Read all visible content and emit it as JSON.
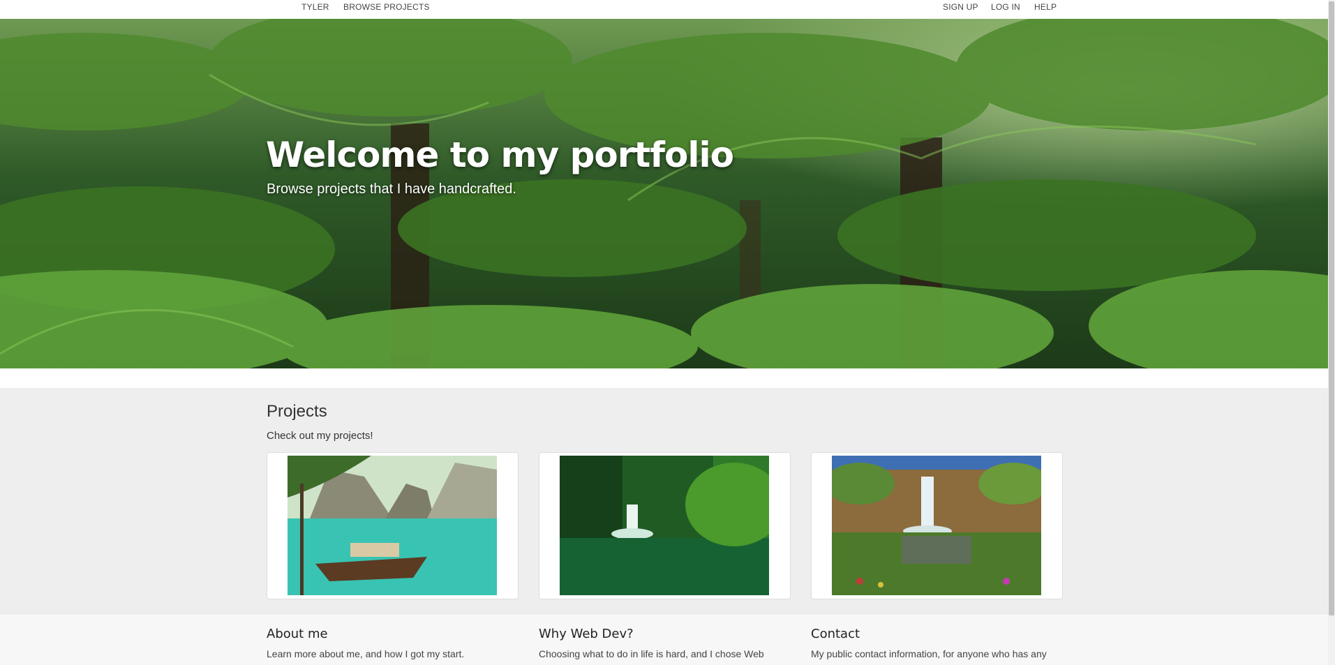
{
  "nav": {
    "brand": "TYLER",
    "browse": "BROWSE PROJECTS",
    "signup": "SIGN UP",
    "login": "LOG IN",
    "help": "HELP"
  },
  "hero": {
    "title": "Welcome to my portfolio",
    "subtitle": "Browse projects that I have handcrafted."
  },
  "projects": {
    "title": "Projects",
    "subtitle": "Check out my projects!",
    "cards": [
      "tropical-lagoon-boat-image",
      "jungle-waterfall-image",
      "canyon-waterfall-image"
    ]
  },
  "footer": {
    "about": {
      "title": "About me",
      "text": "Learn more about me, and how I got my start."
    },
    "why": {
      "title": "Why Web Dev?",
      "text": "Choosing what to do in life is hard, and I chose Web"
    },
    "contact": {
      "title": "Contact",
      "text": "My public contact information, for anyone who has any"
    }
  }
}
